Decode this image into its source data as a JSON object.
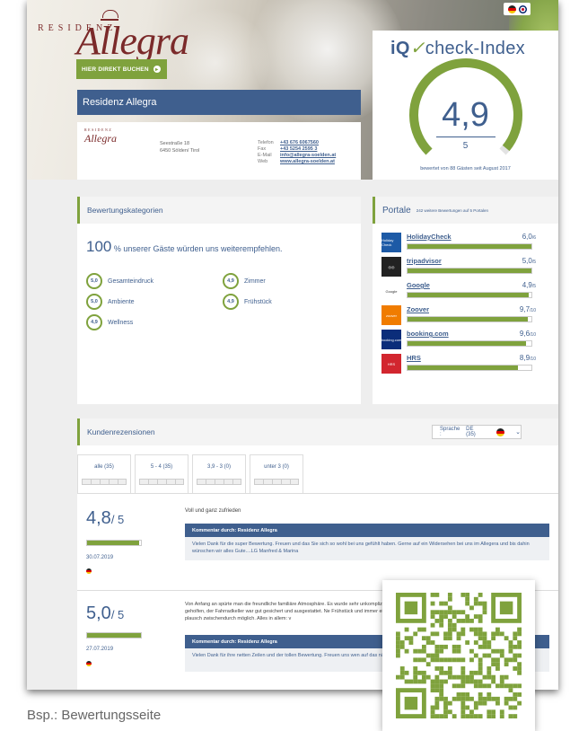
{
  "header": {
    "logo_top": "RESIDENZ",
    "logo_script": "Allegra",
    "book_button": "HIER DIREKT BUCHEN",
    "hotel_name": "Residenz Allegra"
  },
  "contact": {
    "mini_logo": "Allegra",
    "mini_logo_top": "RESIDENZ",
    "street": "Seestraße 18",
    "city": "6450 Sölden/ Tirol",
    "labels": [
      "Telefon",
      "Fax",
      "E-Mail",
      "Web"
    ],
    "values": [
      "+43 676 6067560",
      "+43 5254 2595 3",
      "info@allegra-soelden.at",
      "www.allegra-soelden.at"
    ]
  },
  "iq": {
    "title_pre": "iQ",
    "title_main": "check-Index",
    "score": "4,9",
    "max": "5",
    "score_fraction": 0.98,
    "note": "bewertet von 88 Gästen seit August 2017"
  },
  "categories": {
    "title": "Bewertungskategorien",
    "percent": "100",
    "percent_sign": "%",
    "recommend_text": "unserer Gäste würden uns weiterempfehlen.",
    "items": [
      {
        "score": "5,0",
        "label": "Gesamteindruck"
      },
      {
        "score": "4,9",
        "label": "Zimmer"
      },
      {
        "score": "5,0",
        "label": "Ambiente"
      },
      {
        "score": "4,9",
        "label": "Frühstück"
      },
      {
        "score": "4,9",
        "label": "Wellness"
      }
    ]
  },
  "portals": {
    "title": "Portale",
    "subtitle": "242 weitere Bewertungen auf 5 Portalen",
    "items": [
      {
        "name": "HolidayCheck",
        "score": "6,0",
        "max": "/6",
        "fraction": 1.0,
        "logo_text": "Holiday Check",
        "logo_color": "#1d5aa6"
      },
      {
        "name": "tripadvisor",
        "score": "5,0",
        "max": "/5",
        "fraction": 1.0,
        "logo_text": "◎◎",
        "logo_color": "#222222"
      },
      {
        "name": "Google",
        "score": "4,9",
        "max": "/5",
        "fraction": 0.98,
        "logo_text": "Google",
        "logo_color": "#ffffff"
      },
      {
        "name": "Zoover",
        "score": "9,7",
        "max": "/10",
        "fraction": 0.97,
        "logo_text": "zoover",
        "logo_color": "#f07c00"
      },
      {
        "name": "booking.com",
        "score": "9,6",
        "max": "/10",
        "fraction": 0.96,
        "logo_text": "booking.com",
        "logo_color": "#0b2d7a"
      },
      {
        "name": "HRS",
        "score": "8,9",
        "max": "/10",
        "fraction": 0.89,
        "logo_text": "HRS",
        "logo_color": "#d2262f"
      }
    ]
  },
  "reviews": {
    "title": "Kundenrezensionen",
    "language_label": "Sprache :",
    "language_value": "DE (35)",
    "tabs": [
      "alle (35)",
      "5 - 4 (35)",
      "3,9 - 3 (0)",
      "unter 3 (0)"
    ],
    "items": [
      {
        "score": "4,8",
        "max": "/ 5",
        "fraction": 0.96,
        "date": "30.07.2019",
        "title": "Voll und ganz zufrieden",
        "text": "",
        "comment_head": "Kommentar durch: Residenz Allegra",
        "comment": "Vielen Dank für die super Bewertung. Freuen und das Sie sich so wohl bei uns gefühlt haben. Gerne auf ein Widersehen bei uns im Allegera und bis dahin wünschen wir alles Gute....LG Manfred & Marina"
      },
      {
        "score": "5,0",
        "max": "/ 5",
        "fraction": 1.0,
        "date": "27.07.2019",
        "title": "",
        "text": "Von Anfang an spürte man die freundliche familiäre Atmosphäre. Es wurde sehr unkompliziert geholfen, der Fahrradkeller war gut gesichert und ausgestattet. Ne Frühstück und immer ein netter plausch zwischendurch möglich. Alles in allem: v",
        "comment_head": "Kommentar durch: Residenz Allegra",
        "comment": "Vielen Dank für ihre netten Zeilen und der tollen Bewertung. Freuen uns wen auf das nächste mal bei uns im Allegra... LG Manfred & Marina"
      }
    ]
  },
  "caption": "Bsp.: Bewertungsseite",
  "colors": {
    "accent": "#7fa23d",
    "brand": "#3f5f8e",
    "logo": "#7b2a2a"
  }
}
